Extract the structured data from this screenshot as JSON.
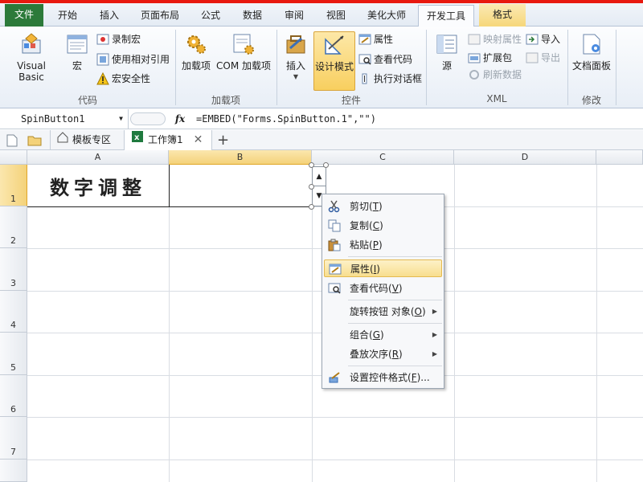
{
  "tabs": [
    {
      "label": "文件"
    },
    {
      "label": "开始"
    },
    {
      "label": "插入"
    },
    {
      "label": "页面布局"
    },
    {
      "label": "公式"
    },
    {
      "label": "数据"
    },
    {
      "label": "审阅"
    },
    {
      "label": "视图"
    },
    {
      "label": "美化大师"
    },
    {
      "label": "开发工具"
    },
    {
      "label": "格式"
    }
  ],
  "ribbon": {
    "code": {
      "label": "代码",
      "visual_basic": "Visual Basic",
      "macro": "宏",
      "record_macro": "录制宏",
      "relative_ref": "使用相对引用",
      "macro_security": "宏安全性"
    },
    "addins": {
      "label": "加载项",
      "addins": "加载项",
      "com_addins": "COM 加载项"
    },
    "controls": {
      "label": "控件",
      "insert": "插入",
      "design_mode": "设计模式",
      "properties": "属性",
      "view_code": "查看代码",
      "run_dialog": "执行对话框"
    },
    "xml": {
      "label": "XML",
      "source": "源",
      "map_properties": "映射属性",
      "expansion_packs": "扩展包",
      "refresh_data": "刷新数据",
      "import": "导入",
      "export": "导出"
    },
    "modify": {
      "label": "修改",
      "document_panel": "文档面板"
    }
  },
  "formula_bar": {
    "name_box": "SpinButton1",
    "fx": "fx",
    "formula": "=EMBED(\"Forms.SpinButton.1\",\"\")"
  },
  "doc_tabs": {
    "template": "模板专区",
    "workbook": "工作簿1",
    "add": "+"
  },
  "sheet": {
    "columns": [
      "A",
      "B",
      "C",
      "D"
    ],
    "rows": [
      "1",
      "2",
      "3",
      "4",
      "5",
      "6",
      "7"
    ],
    "cell_a1": "数字调整"
  },
  "context_menu": {
    "cut": {
      "label": "剪切",
      "key": "T"
    },
    "copy": {
      "label": "复制",
      "key": "C"
    },
    "paste": {
      "label": "粘贴",
      "key": "P"
    },
    "properties": {
      "label": "属性",
      "key": "I"
    },
    "view_code": {
      "label": "查看代码",
      "key": "V"
    },
    "spin_object": {
      "label": "旋转按钮 对象",
      "key": "O"
    },
    "group": {
      "label": "组合",
      "key": "G"
    },
    "order": {
      "label": "叠放次序",
      "key": "R"
    },
    "format_control": {
      "label": "设置控件格式",
      "key": "F",
      "suffix": "..."
    }
  },
  "colors": {
    "file_tab": "#2c7a3a",
    "accent": "#f8cf5f",
    "red_strip": "#e8190f"
  }
}
